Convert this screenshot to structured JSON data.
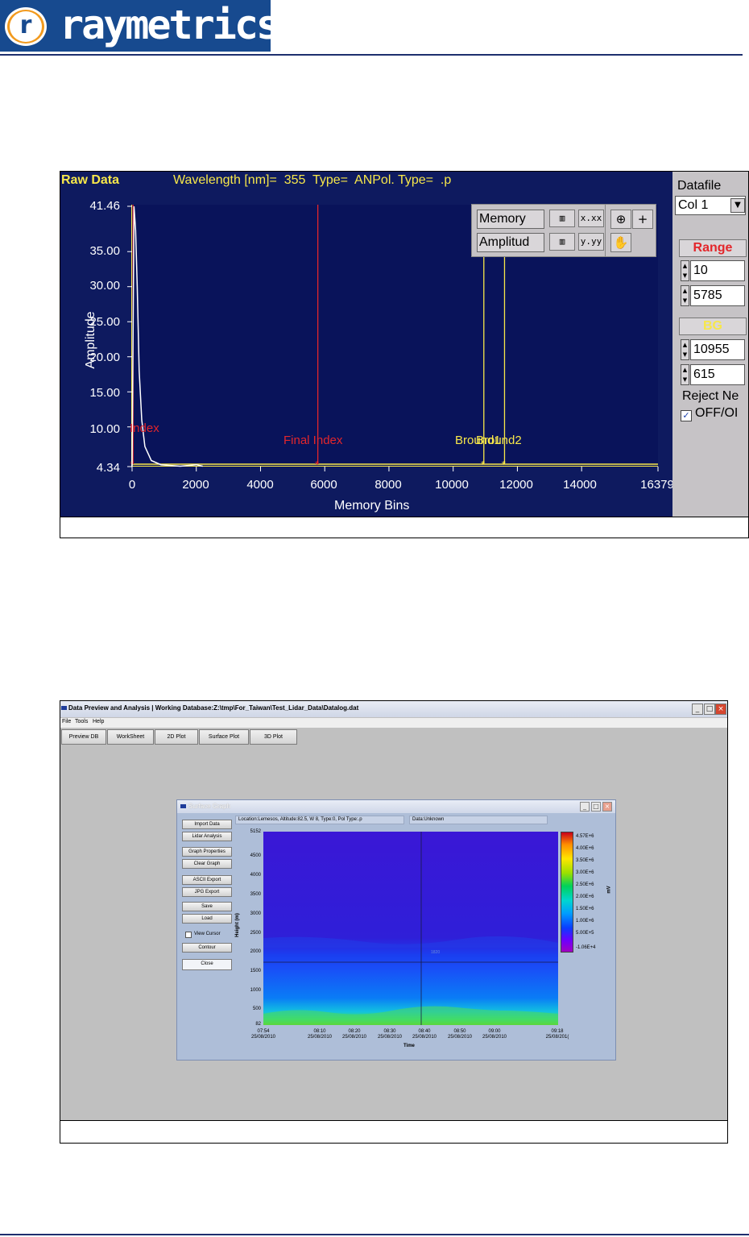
{
  "header": {
    "logo_text": "raymetrics",
    "logo_letter": "r"
  },
  "figure1": {
    "title": "Raw Data",
    "info": "Wavelength [nm]=  355  Type=  ANPol. Type=  .p",
    "ylabel": "Amplitude",
    "xlabel": "Memory Bins",
    "yticks": [
      "41.46",
      "35.00",
      "30.00",
      "25.00",
      "20.00",
      "15.00",
      "10.00",
      "4.34"
    ],
    "xticks": [
      "0",
      "2000",
      "4000",
      "6000",
      "8000",
      "10000",
      "12000",
      "14000",
      "16379"
    ],
    "cursors": {
      "initial": "Index",
      "final": "Final Index",
      "bg1": "Bround1",
      "bg2": "Bround2"
    },
    "legend": {
      "row1": "Memory",
      "row2": "Amplitud",
      "fmt_x": "x.xx",
      "fmt_y": "y.yy",
      "plus": "+"
    },
    "side": {
      "datafile_label": "Datafile",
      "datafile_value": "Col 1",
      "range_head": "Range",
      "range_start": "10",
      "range_end": "5785",
      "bg_head": "BG",
      "bg_start": "10955",
      "bg_end": "615",
      "reject_label": "Reject Ne",
      "toggle_label": "OFF/OI"
    },
    "colors": {
      "bg": "#0e1a5f",
      "trace": "#ffffff",
      "cursor_red": "#e3262b",
      "cursor_yellow": "#f7e74a"
    },
    "chart_data": {
      "type": "line",
      "xlabel": "Memory Bins",
      "ylabel": "Amplitude",
      "xlim": [
        0,
        16379
      ],
      "ylim": [
        4.34,
        41.46
      ],
      "series": [
        {
          "x": [
            0,
            60,
            110,
            160,
            220,
            300,
            400,
            600,
            900,
            1500,
            2000,
            2200
          ],
          "y": [
            4.34,
            41.46,
            38,
            30,
            18,
            11,
            7.2,
            5.2,
            4.6,
            4.4,
            4.6,
            4.4
          ]
        }
      ],
      "cursors_x": [
        30,
        5785,
        10955,
        11600
      ]
    }
  },
  "figure2": {
    "window_title": "Data Preview and Analysis  |  Working Database:Z:\\tmp\\For_Taiwan\\Test_Lidar_Data\\Datalog.dat",
    "menu": [
      "File",
      "Tools",
      "Help"
    ],
    "tabs": [
      "Preview DB",
      "WorkSheet",
      "2D Plot",
      "Surface Plot",
      "3D Plot"
    ],
    "surface": {
      "title": "Surface Graph",
      "location": "Location:Lemesos, Altitude:82.5, W 8, Type:0, Pol Type:.p",
      "data": "Data:Unknown",
      "buttons": [
        "Import Data",
        "Lidar Analysis",
        "Graph Properties",
        "Clear Graph",
        "ASCII Export",
        "JPG Export",
        "Save",
        "Load",
        "Contour",
        "Close"
      ],
      "view_cursor": "View Cursor",
      "yticks": [
        "5152",
        "4500",
        "4000",
        "3500",
        "3000",
        "2500",
        "2000",
        "1500",
        "1000",
        "500",
        "82"
      ],
      "ylabel": "Height (m)",
      "xticks": [
        "07:54\n25/08/2010",
        "08:10\n25/08/2010",
        "08:20\n25/08/2010",
        "08:30\n25/08/2010",
        "08:40\n25/08/2010",
        "08:50\n25/08/2010",
        "09:00\n25/08/2010",
        "09:18\n25/08/201("
      ],
      "xlabel": "Time",
      "cbar_ticks": [
        "4.57E+6",
        "4.00E+6",
        "3.50E+6",
        "3.00E+6",
        "2.50E+6",
        "2.00E+6",
        "1.50E+6",
        "1.00E+6",
        "5.00E+5",
        "-1.06E+4"
      ],
      "cbar_label": "mV",
      "cursor_label": "1820"
    }
  }
}
